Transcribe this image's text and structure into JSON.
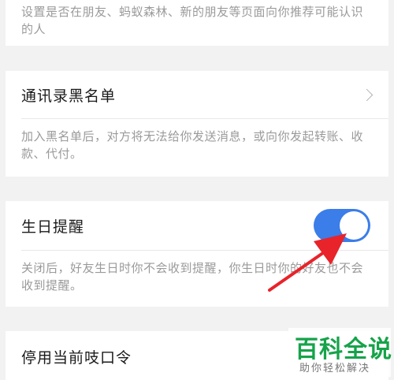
{
  "recommend_section": {
    "description": "设置是否在朋友、蚂蚁森林、新的朋友等页面向你推荐可能认识的人"
  },
  "blacklist_section": {
    "label": "通讯录黑名单",
    "description": "加入黑名单后，对方将无法给你发送消息，或向你发起转账、收款、代付。"
  },
  "birthday_section": {
    "label": "生日提醒",
    "toggle_on": true,
    "description": "关闭后，好友生日时你不会收到提醒，你生日时你的好友也不会收到提醒。"
  },
  "command_section": {
    "label": "停用当前吱口令"
  },
  "watermark": {
    "title": "百科全说",
    "subtitle": "助你轻松解决"
  },
  "colors": {
    "toggle_on": "#3b7de9",
    "annotation_arrow": "#e8232a",
    "watermark_green": "#16a34a"
  }
}
